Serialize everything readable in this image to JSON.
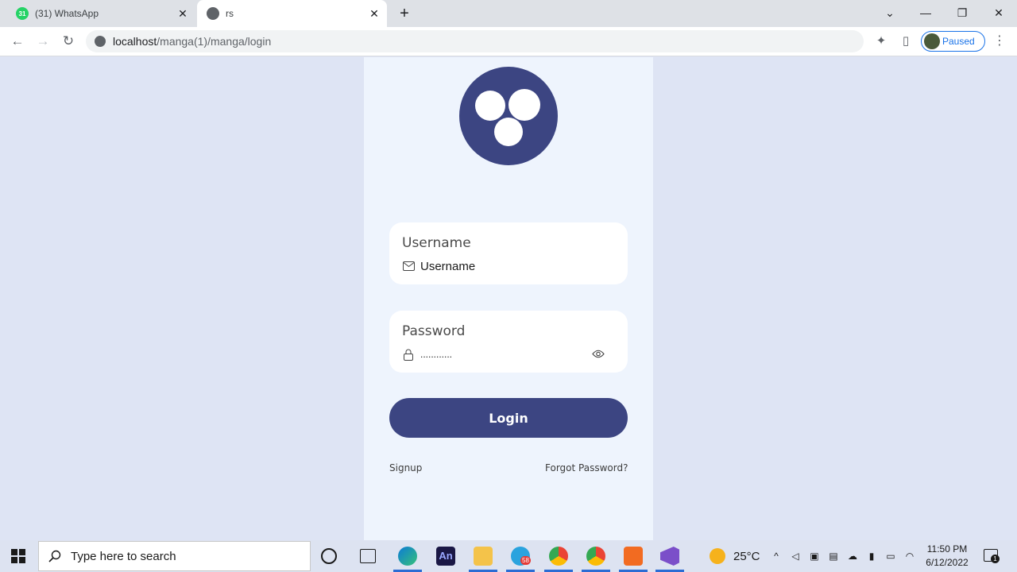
{
  "browser": {
    "tabs": [
      {
        "title": "(31) WhatsApp",
        "favicon": "whatsapp-icon",
        "badge": "31"
      },
      {
        "title": "rs",
        "favicon": "globe-icon"
      }
    ],
    "url_host": "localhost",
    "url_path": "/manga(1)/manga/login",
    "profile_status": "Paused"
  },
  "login": {
    "username_label": "Username",
    "username_placeholder": "Username",
    "password_label": "Password",
    "password_value": "............",
    "login_button": "Login",
    "signup_link": "Signup",
    "forgot_link": "Forgot Password?",
    "brand_color": "#3c4582"
  },
  "taskbar": {
    "search_placeholder": "Type here to search",
    "telegram_badge": "58",
    "temperature": "25°C",
    "time": "11:50 PM",
    "date": "6/12/2022",
    "notification_count": "1"
  }
}
